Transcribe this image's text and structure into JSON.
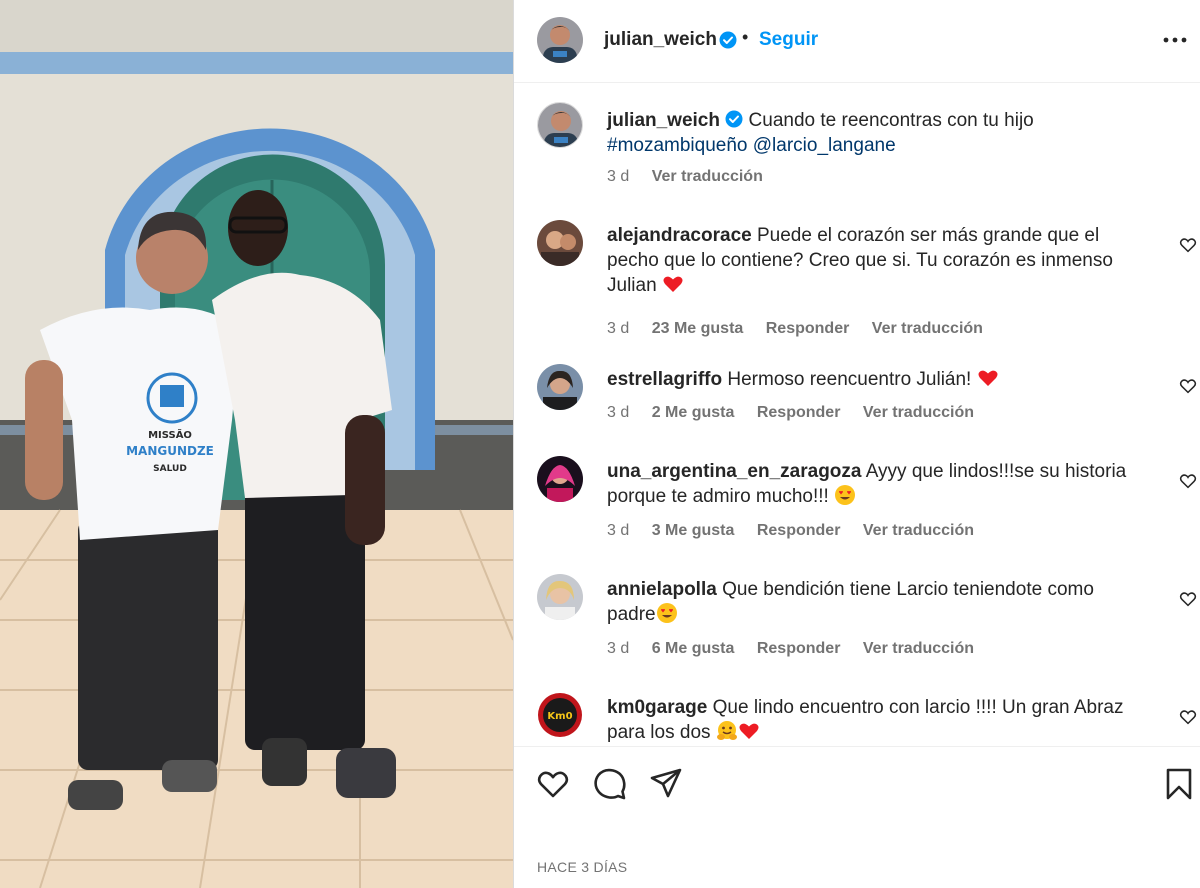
{
  "post": {
    "username": "julian_weich",
    "follow_label": "Seguir",
    "separator": "•",
    "caption_text": "Cuando te reencontras con tu hijo",
    "caption_hashtag": "#mozambiqueño",
    "caption_mention": "@larcio_langane",
    "caption_age": "3 d",
    "translate_label": "Ver traducción",
    "shirt_lines": [
      "MISSÃO",
      "MANGUNDZE",
      "SALUD"
    ],
    "posted_label": "HACE 3 DÍAS",
    "colors": {
      "link": "#0095f6",
      "heart": "#ed1c24",
      "hashtag": "#00376b"
    }
  },
  "comments": [
    {
      "username": "alejandracorace",
      "text": "Puede el corazón ser más grande que el pecho que lo contiene? Creo que si. Tu corazón es inmenso Julian",
      "emoji": [
        "red-heart"
      ],
      "age": "3 d",
      "likes": "23 Me gusta",
      "reply": "Responder",
      "translate": "Ver traducción"
    },
    {
      "username": "estrellagriffo",
      "text": "Hermoso reencuentro Julián!",
      "emoji": [
        "red-heart"
      ],
      "age": "3 d",
      "likes": "2 Me gusta",
      "reply": "Responder",
      "translate": "Ver traducción"
    },
    {
      "username": "una_argentina_en_zaragoza",
      "text": "Ayyy que lindos!!!se su historia porque te admiro mucho!!!",
      "emoji": [
        "heart-eyes"
      ],
      "age": "3 d",
      "likes": "3 Me gusta",
      "reply": "Responder",
      "translate": "Ver traducción"
    },
    {
      "username": "annielapolla",
      "text": "Que bendición tiene Larcio teniendote como padre",
      "emoji": [
        "heart-eyes"
      ],
      "age": "3 d",
      "likes": "6 Me gusta",
      "reply": "Responder",
      "translate": "Ver traducción"
    },
    {
      "username": "km0garage",
      "text": "Que lindo encuentro con larcio !!!! Un gran Abraz para los dos",
      "emoji": [
        "hugging",
        "red-heart"
      ],
      "age": "",
      "likes": "",
      "reply": "",
      "translate": ""
    }
  ],
  "icons": [
    "verified-badge",
    "more-options",
    "heart-outline",
    "comment-bubble",
    "share-plane",
    "bookmark"
  ]
}
